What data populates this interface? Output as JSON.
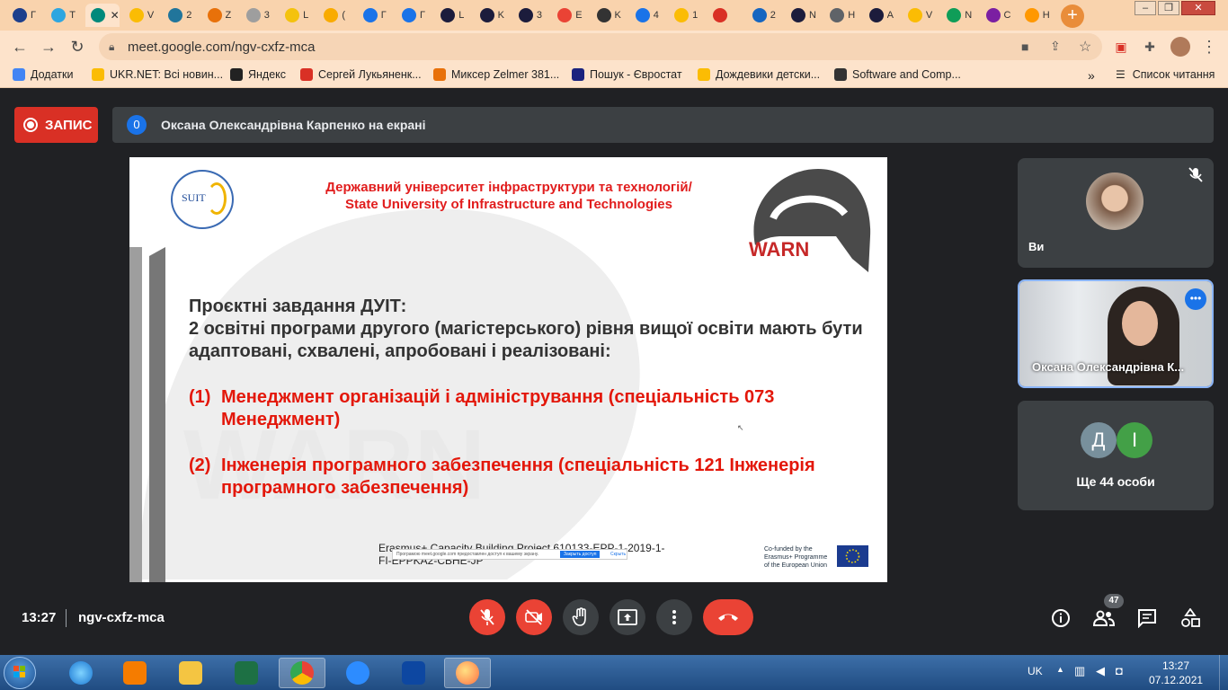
{
  "browser": {
    "tabs": [
      {
        "label": "Г",
        "color": "#1d3f8c"
      },
      {
        "label": "Т",
        "color": "#2ea6e0"
      },
      {
        "label": "М",
        "color": "#00897b"
      },
      {
        "label": "V",
        "color": "#fbbc04"
      },
      {
        "label": "2",
        "color": "#21759b"
      },
      {
        "label": "Z",
        "color": "#e8710a"
      },
      {
        "label": "3",
        "color": "#9e9e9e"
      },
      {
        "label": "L",
        "color": "#f4c20d"
      },
      {
        "label": "(",
        "color": "#f9ab00"
      },
      {
        "label": "Г",
        "color": "#1a73e8"
      },
      {
        "label": "Г",
        "color": "#1a73e8"
      },
      {
        "label": "L",
        "color": "#1c1c3c"
      },
      {
        "label": "K",
        "color": "#1c1c3c"
      },
      {
        "label": "3",
        "color": "#1c1c3c"
      },
      {
        "label": "E",
        "color": "#ea4335"
      },
      {
        "label": "K",
        "color": "#333333"
      },
      {
        "label": "4",
        "color": "#1a73e8"
      },
      {
        "label": "1",
        "color": "#fbbc04"
      },
      {
        "label": "",
        "color": "#d93025"
      },
      {
        "label": "2",
        "color": "#1565c0"
      },
      {
        "label": "N",
        "color": "#1c1c3c"
      },
      {
        "label": "H",
        "color": "#5f6368"
      },
      {
        "label": "A",
        "color": "#1c1c3c"
      },
      {
        "label": "V",
        "color": "#fbbc04"
      },
      {
        "label": "N",
        "color": "#0f9d58"
      },
      {
        "label": "C",
        "color": "#7b1fa2"
      },
      {
        "label": "H",
        "color": "#ff9800"
      }
    ],
    "active_tab_label": "М",
    "url": "meet.google.com/ngv-cxfz-mca",
    "bookmarks": [
      {
        "label": "Додатки",
        "color": "#4285f4"
      },
      {
        "label": "UKR.NET: Всі новин...",
        "color": "#fbbc04"
      },
      {
        "label": "Яндекс",
        "color": "#222222"
      },
      {
        "label": "Сергей Лукьяненк...",
        "color": "#d93025"
      },
      {
        "label": "Миксер Zelmer 381...",
        "color": "#e8710a"
      },
      {
        "label": "Пошук - Євростат",
        "color": "#1a237e"
      },
      {
        "label": "Дождевики детски...",
        "color": "#fbbc04"
      },
      {
        "label": "Software and Comp...",
        "color": "#333333"
      }
    ],
    "reading_list": "Список читання",
    "more_bookmarks": "»"
  },
  "meet": {
    "record_label": "ЗАПИС",
    "presenting_badge": "0",
    "presenting_text": "Оксана Олександрівна Карпенко на екрані",
    "slide": {
      "logo_text": "SUIT",
      "university_line1": "Державний університет інфраструктури та технологій/",
      "university_line2": "State University of Infrastructure and Technologies",
      "warn_logo": "WARN",
      "heading": "Проєктні завдання ДУІТ:",
      "intro": "2 освітні програми другого (магістерського) рівня вищої освіти мають бути адаптовані, схвалені, апробовані і реалізовані:",
      "items": [
        {
          "num": "(1)",
          "text": "Менеджмент організацій і адміністрування  (спеціальність 073 Менеджмент)"
        },
        {
          "num": "(2)",
          "text": "Інженерія програмного забезпечення (спеціальність 121 Інженерія програмного забезпечення)"
        }
      ],
      "footer_line1": "Erasmus+ Capacity Building Project 610133-EPP-1-2019-1-",
      "footer_line2": "FI-EPPKA2-CBHE-JP",
      "cofunded": [
        "Co-funded by the",
        "Erasmus+ Programme",
        "of the European Union"
      ],
      "toast_text": "Програмою meet.google.com предоставлен доступ к вашему экрану.",
      "toast_button": "Закрыть доступ",
      "toast_hide": "Скрыть"
    },
    "tiles": [
      {
        "name": "Ви",
        "muted": true
      },
      {
        "name": "Оксана Олександрівна К...",
        "speaking": true
      },
      {
        "name": "Ще 44 особи",
        "avatars": [
          {
            "letter": "Д",
            "color": "#78909c"
          },
          {
            "letter": "І",
            "color": "#43a047"
          }
        ]
      }
    ],
    "time": "13:27",
    "meeting_code": "ngv-cxfz-mca",
    "participant_count": "47"
  },
  "taskbar": {
    "language": "UK",
    "clock_time": "13:27",
    "clock_date": "07.12.2021"
  }
}
